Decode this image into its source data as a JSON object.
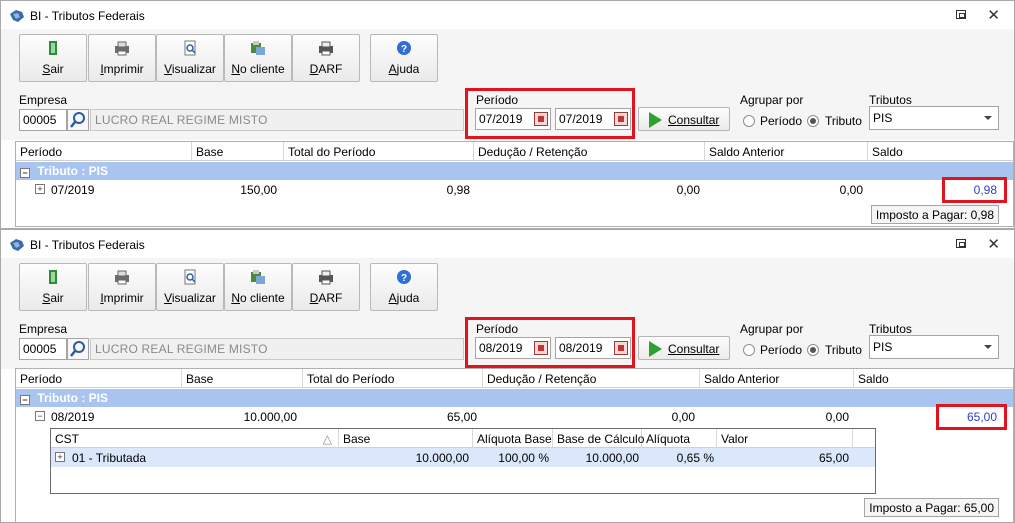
{
  "windows": [
    {
      "title": "BI - Tributos Federais",
      "toolbar": [
        {
          "key": "S",
          "rest": "air",
          "icon": "exit-icon"
        },
        {
          "key": "I",
          "rest": "mprimir",
          "icon": "printer-icon"
        },
        {
          "key": "V",
          "rest": "isualizar",
          "icon": "preview-icon"
        },
        {
          "key": "N",
          "rest": "o cliente",
          "icon": "client-icon"
        },
        {
          "key": "D",
          "rest": "ARF",
          "icon": "darf-printer-icon"
        },
        {
          "key": "A",
          "rest": "juda",
          "icon": "help-icon"
        }
      ],
      "empresa_label": "Empresa",
      "empresa_code": "00005",
      "empresa_name": "LUCRO REAL REGIME MISTO",
      "periodo_label": "Período",
      "periodo_from": "07/2019",
      "periodo_to": "07/2019",
      "consultar": {
        "key": "C",
        "rest": "onsultar"
      },
      "agrupar_label": "Agrupar por",
      "agrupar_options": [
        "Período",
        "Tributo"
      ],
      "agrupar_selected": "Tributo",
      "tributos_label": "Tributos",
      "tributos_value": "PIS",
      "grid_headers": [
        "Período",
        "Base",
        "Total do Período",
        "Dedução / Retenção",
        "Saldo Anterior",
        "Saldo"
      ],
      "group_label": "Tributo : PIS",
      "rows": [
        {
          "periodo": "07/2019",
          "base": "150,00",
          "total": "0,98",
          "deducao": "0,00",
          "saldo_anterior": "0,00",
          "saldo": "0,98"
        }
      ],
      "imposto_label": "Imposto a Pagar: 0,98"
    },
    {
      "title": "BI - Tributos Federais",
      "toolbar": [
        {
          "key": "S",
          "rest": "air",
          "icon": "exit-icon"
        },
        {
          "key": "I",
          "rest": "mprimir",
          "icon": "printer-icon"
        },
        {
          "key": "V",
          "rest": "isualizar",
          "icon": "preview-icon"
        },
        {
          "key": "N",
          "rest": "o cliente",
          "icon": "client-icon"
        },
        {
          "key": "D",
          "rest": "ARF",
          "icon": "darf-printer-icon"
        },
        {
          "key": "A",
          "rest": "juda",
          "icon": "help-icon"
        }
      ],
      "empresa_label": "Empresa",
      "empresa_code": "00005",
      "empresa_name": "LUCRO REAL REGIME MISTO",
      "periodo_label": "Período",
      "periodo_from": "08/2019",
      "periodo_to": "08/2019",
      "consultar": {
        "key": "C",
        "rest": "onsultar"
      },
      "agrupar_label": "Agrupar por",
      "agrupar_options": [
        "Período",
        "Tributo"
      ],
      "agrupar_selected": "Tributo",
      "tributos_label": "Tributos",
      "tributos_value": "PIS",
      "grid_headers": [
        "Período",
        "Base",
        "Total do Período",
        "Dedução / Retenção",
        "Saldo Anterior",
        "Saldo"
      ],
      "group_label": "Tributo : PIS",
      "rows": [
        {
          "periodo": "08/2019",
          "base": "10.000,00",
          "total": "65,00",
          "deducao": "0,00",
          "saldo_anterior": "0,00",
          "saldo": "65,00"
        }
      ],
      "detail": {
        "headers": [
          "CST",
          "Base",
          "Alíquota Base",
          "Base de Cálculo",
          "Alíquota",
          "Valor"
        ],
        "sort_indicator": "△",
        "rows": [
          {
            "cst": "01 - Tributada",
            "base": "10.000,00",
            "aliquota_base": "100,00 %",
            "base_calculo": "10.000,00",
            "aliquota": "0,65 %",
            "valor": "65,00"
          }
        ]
      },
      "imposto_label": "Imposto a Pagar: 65,00"
    }
  ],
  "colors": {
    "group_band": "#a9c4ef",
    "highlight_border": "#e1141e",
    "saldo_link": "#2b3fd0",
    "detail_row": "#dbe7fb"
  }
}
